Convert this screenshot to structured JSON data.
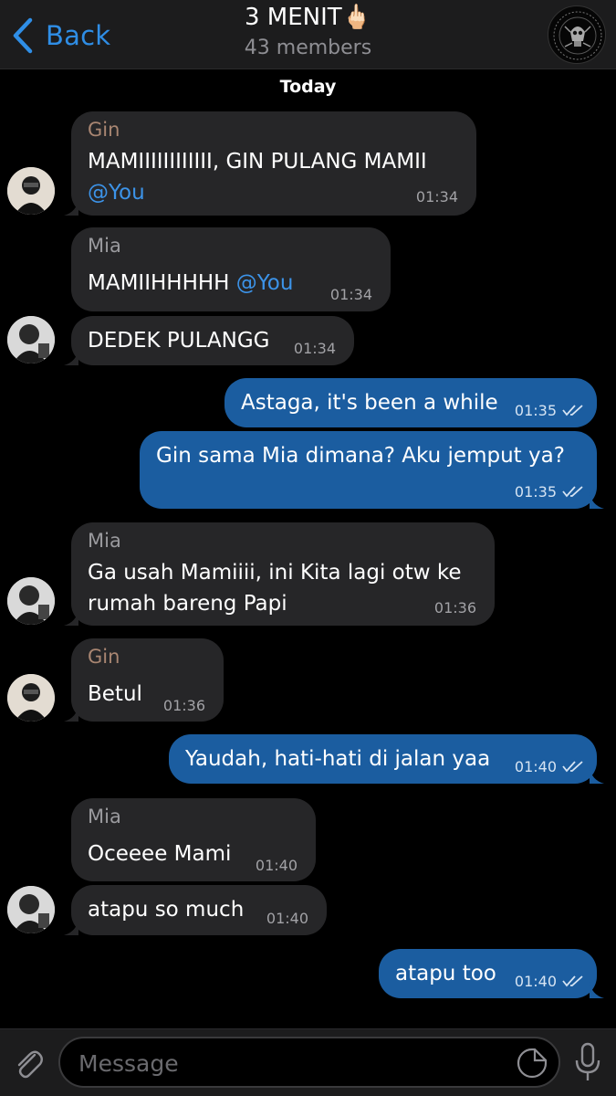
{
  "header": {
    "back_label": "Back",
    "title": "3 MENIT🖕🏻",
    "subtitle": "43 members",
    "group_avatar_icon": "skull-crest-icon"
  },
  "date_label": "Today",
  "messages": [
    {
      "sender": "Gin",
      "text": "MAMIIIIIIIIIIII, GIN PULANG MAMII",
      "mention": "@You",
      "time": "01:34"
    },
    {
      "sender": "Mia",
      "text": "MAMIIHHHHH",
      "mention": "@You",
      "time": "01:34"
    },
    {
      "text": "DEDEK PULANGG",
      "time": "01:34"
    },
    {
      "text": "Astaga, it's been a while",
      "time": "01:35"
    },
    {
      "text": "Gin sama Mia dimana? Aku jemput ya?",
      "time": "01:35"
    },
    {
      "sender": "Mia",
      "lines": [
        "Ga usah Mamiiii, ini Kita lagi otw ke",
        "rumah bareng Papi"
      ],
      "time": "01:36"
    },
    {
      "sender": "Gin",
      "text": "Betul",
      "time": "01:36"
    },
    {
      "text": "Yaudah, hati-hati di jalan yaa",
      "time": "01:40"
    },
    {
      "sender": "Mia",
      "text": "Oceeee Mami",
      "time": "01:40"
    },
    {
      "text": "atapu so much",
      "time": "01:40"
    },
    {
      "text": "atapu too",
      "time": "01:40"
    }
  ],
  "input": {
    "placeholder": "Message"
  },
  "colors": {
    "accent": "#2f8ee6",
    "outgoing_bubble": "#1b5da0",
    "incoming_bubble": "#262628",
    "gin_name": "#a98672",
    "mia_name": "#9a9a9e"
  }
}
